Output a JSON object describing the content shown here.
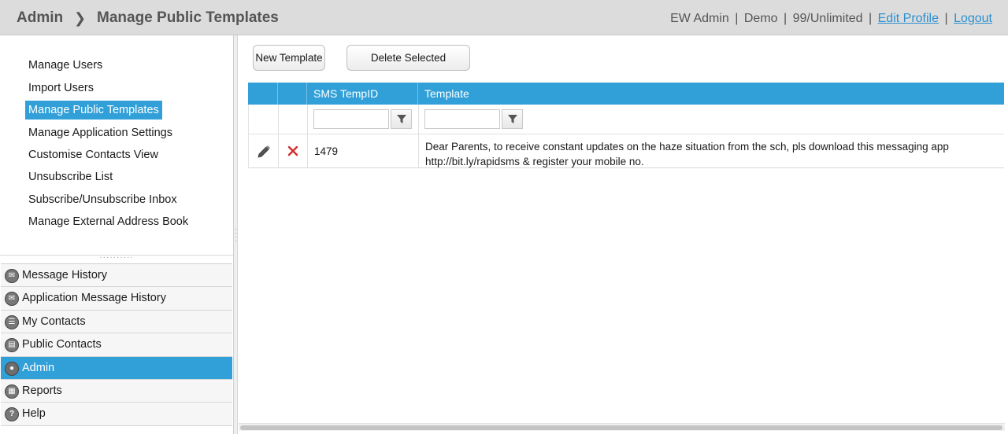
{
  "header": {
    "breadcrumb_root": "Admin",
    "breadcrumb_sep": "❯",
    "page_title": "Manage Public Templates",
    "user_name": "EW Admin",
    "account": "Demo",
    "quota": "99/Unlimited",
    "edit_profile": "Edit Profile",
    "logout": "Logout",
    "separator": "|"
  },
  "submenu": {
    "items": [
      {
        "label": "Manage Users"
      },
      {
        "label": "Import Users"
      },
      {
        "label": "Manage Public Templates",
        "active": true
      },
      {
        "label": "Manage Application Settings"
      },
      {
        "label": "Customise Contacts View"
      },
      {
        "label": "Unsubscribe List"
      },
      {
        "label": "Subscribe/Unsubscribe Inbox"
      },
      {
        "label": "Manage External Address Book"
      }
    ]
  },
  "mainmenu": {
    "items": [
      {
        "label": "Message History",
        "icon": "message-history-icon"
      },
      {
        "label": "Application Message History",
        "icon": "application-message-icon"
      },
      {
        "label": "My Contacts",
        "icon": "contacts-icon"
      },
      {
        "label": "Public Contacts",
        "icon": "public-contacts-icon"
      },
      {
        "label": "Admin",
        "icon": "admin-user-icon",
        "active": true
      },
      {
        "label": "Reports",
        "icon": "reports-icon"
      },
      {
        "label": "Help",
        "icon": "help-icon"
      }
    ]
  },
  "toolbar": {
    "new_label": "New Template",
    "delete_label": "Delete Selected"
  },
  "grid": {
    "columns": [
      "",
      "",
      "SMS TempID",
      "Template"
    ],
    "rows": [
      {
        "id": "1479",
        "template_line1": "Dear Parents, to receive constant updates on the haze situation from the sch, pls download this messaging app",
        "template_line2": "http://bit.ly/rapidsms & register your mobile no."
      }
    ]
  },
  "colors": {
    "accent": "#31a0d8",
    "link": "#2a8fd0",
    "delete": "#d42a2a"
  }
}
